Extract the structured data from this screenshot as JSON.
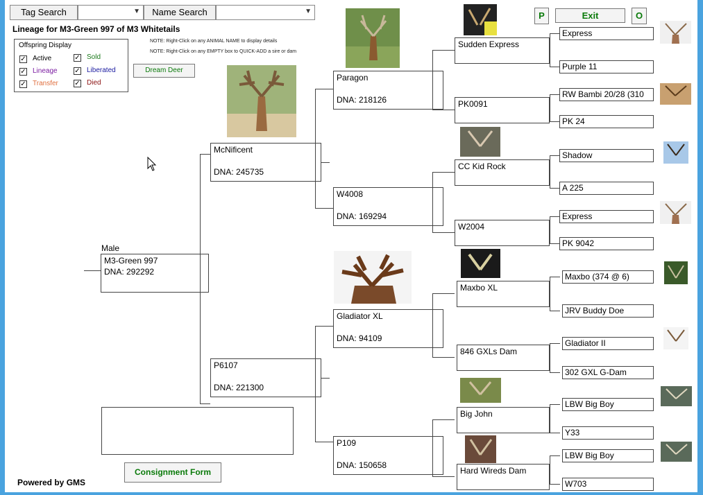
{
  "toolbar": {
    "tag_search_label": "Tag Search",
    "name_search_label": "Name Search",
    "p_label": "P",
    "exit_label": "Exit",
    "o_label": "O"
  },
  "header": {
    "title": "Lineage for M3-Green 997 of M3 Whitetails",
    "note1": "NOTE: Right-Click on any ANIMAL NAME to display details",
    "note2": "NOTE: Right-Click on any EMPTY box to QUICK-ADD a sire or dam"
  },
  "offspring": {
    "title": "Offspring Display",
    "items": [
      {
        "label": "Active",
        "color": "#000000"
      },
      {
        "label": "Sold",
        "color": "#1a7a1a"
      },
      {
        "label": "Lineage",
        "color": "#7a1aa0"
      },
      {
        "label": "Liberated",
        "color": "#1a1aa0"
      },
      {
        "label": "Transfer",
        "color": "#e07040"
      },
      {
        "label": "Died",
        "color": "#8a1010"
      }
    ]
  },
  "buttons": {
    "dream_deer": "Dream Deer",
    "consignment": "Consignment Form"
  },
  "footer": {
    "powered": "Powered by GMS"
  },
  "subject": {
    "sex": "Male",
    "name": "M3-Green 997",
    "dna": "DNA: 292292"
  },
  "gen1": [
    {
      "name": "McNificent",
      "dna": "DNA: 245735"
    },
    {
      "name": "P6107",
      "dna": "DNA: 221300"
    }
  ],
  "gen2": [
    {
      "name": "Paragon",
      "dna": "DNA: 218126"
    },
    {
      "name": "W4008",
      "dna": "DNA: 169294"
    },
    {
      "name": "Gladiator XL",
      "dna": "DNA: 94109"
    },
    {
      "name": "P109",
      "dna": "DNA: 150658"
    }
  ],
  "gen3": [
    {
      "name": "Sudden Express"
    },
    {
      "name": "PK0091"
    },
    {
      "name": "CC Kid Rock"
    },
    {
      "name": "W2004"
    },
    {
      "name": "Maxbo XL"
    },
    {
      "name": "846 GXLs Dam"
    },
    {
      "name": "Big John"
    },
    {
      "name": "Hard Wireds Dam"
    }
  ],
  "gen4": [
    "Express",
    "Purple 11",
    "RW Bambi 20/28 (310",
    "PK 24",
    "Shadow",
    "A 225",
    "Express",
    "PK 9042",
    "Maxbo (374 @ 6)",
    "JRV Buddy Doe",
    "Gladiator II",
    "302 GXL G-Dam",
    "LBW Big Boy",
    "Y33",
    "LBW Big Boy",
    "W703"
  ],
  "colors": {
    "accent_green": "#0a7a0a",
    "window_blue": "#4aa3df"
  }
}
